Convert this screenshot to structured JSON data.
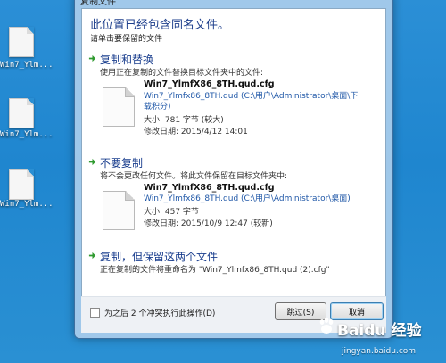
{
  "desktop": {
    "icons": [
      {
        "label": "Win7_Ylm..."
      },
      {
        "label": "Win7_Ylm..."
      },
      {
        "label": "Win7_Ylm..."
      }
    ]
  },
  "dialog": {
    "title": "复制文件",
    "heading": "此位置已经包含同名文件。",
    "subheading": "请单击要保留的文件",
    "options": [
      {
        "title": "复制和替换",
        "description": "使用正在复制的文件替换目标文件夹中的文件:",
        "file": {
          "name": "Win7_YlmfX86_8TH.qud.cfg",
          "path": "Win7_Ylmfx86_8TH.qud (C:\\用户\\Administrator\\桌面\\下载积分)",
          "size": "大小: 781 字节 (较大)",
          "modified": "修改日期: 2015/4/12 14:01"
        }
      },
      {
        "title": "不要复制",
        "description": "将不会更改任何文件。将此文件保留在目标文件夹中:",
        "file": {
          "name": "Win7_YlmfX86_8TH.qud.cfg",
          "path": "Win7_Ylmfx86_8TH.qud (C:\\用户\\Administrator\\桌面)",
          "size": "大小: 457 字节",
          "modified": "修改日期: 2015/10/9 12:47 (较新)"
        }
      },
      {
        "title": "复制，但保留这两个文件",
        "description": "正在复制的文件将重命名为 \"Win7_Ylmfx86_8TH.qud (2).cfg\""
      }
    ],
    "checkbox_label": "为之后 2 个冲突执行此操作(D)",
    "skip_label": "跳过(S)",
    "cancel_label": "取消"
  },
  "watermark": {
    "brand": "Baidu 经验",
    "url": "jingyan.baidu.com"
  },
  "colors": {
    "desktop": "#2389d2",
    "link": "#1a3e8e",
    "arrow": "#2f9a2f"
  }
}
